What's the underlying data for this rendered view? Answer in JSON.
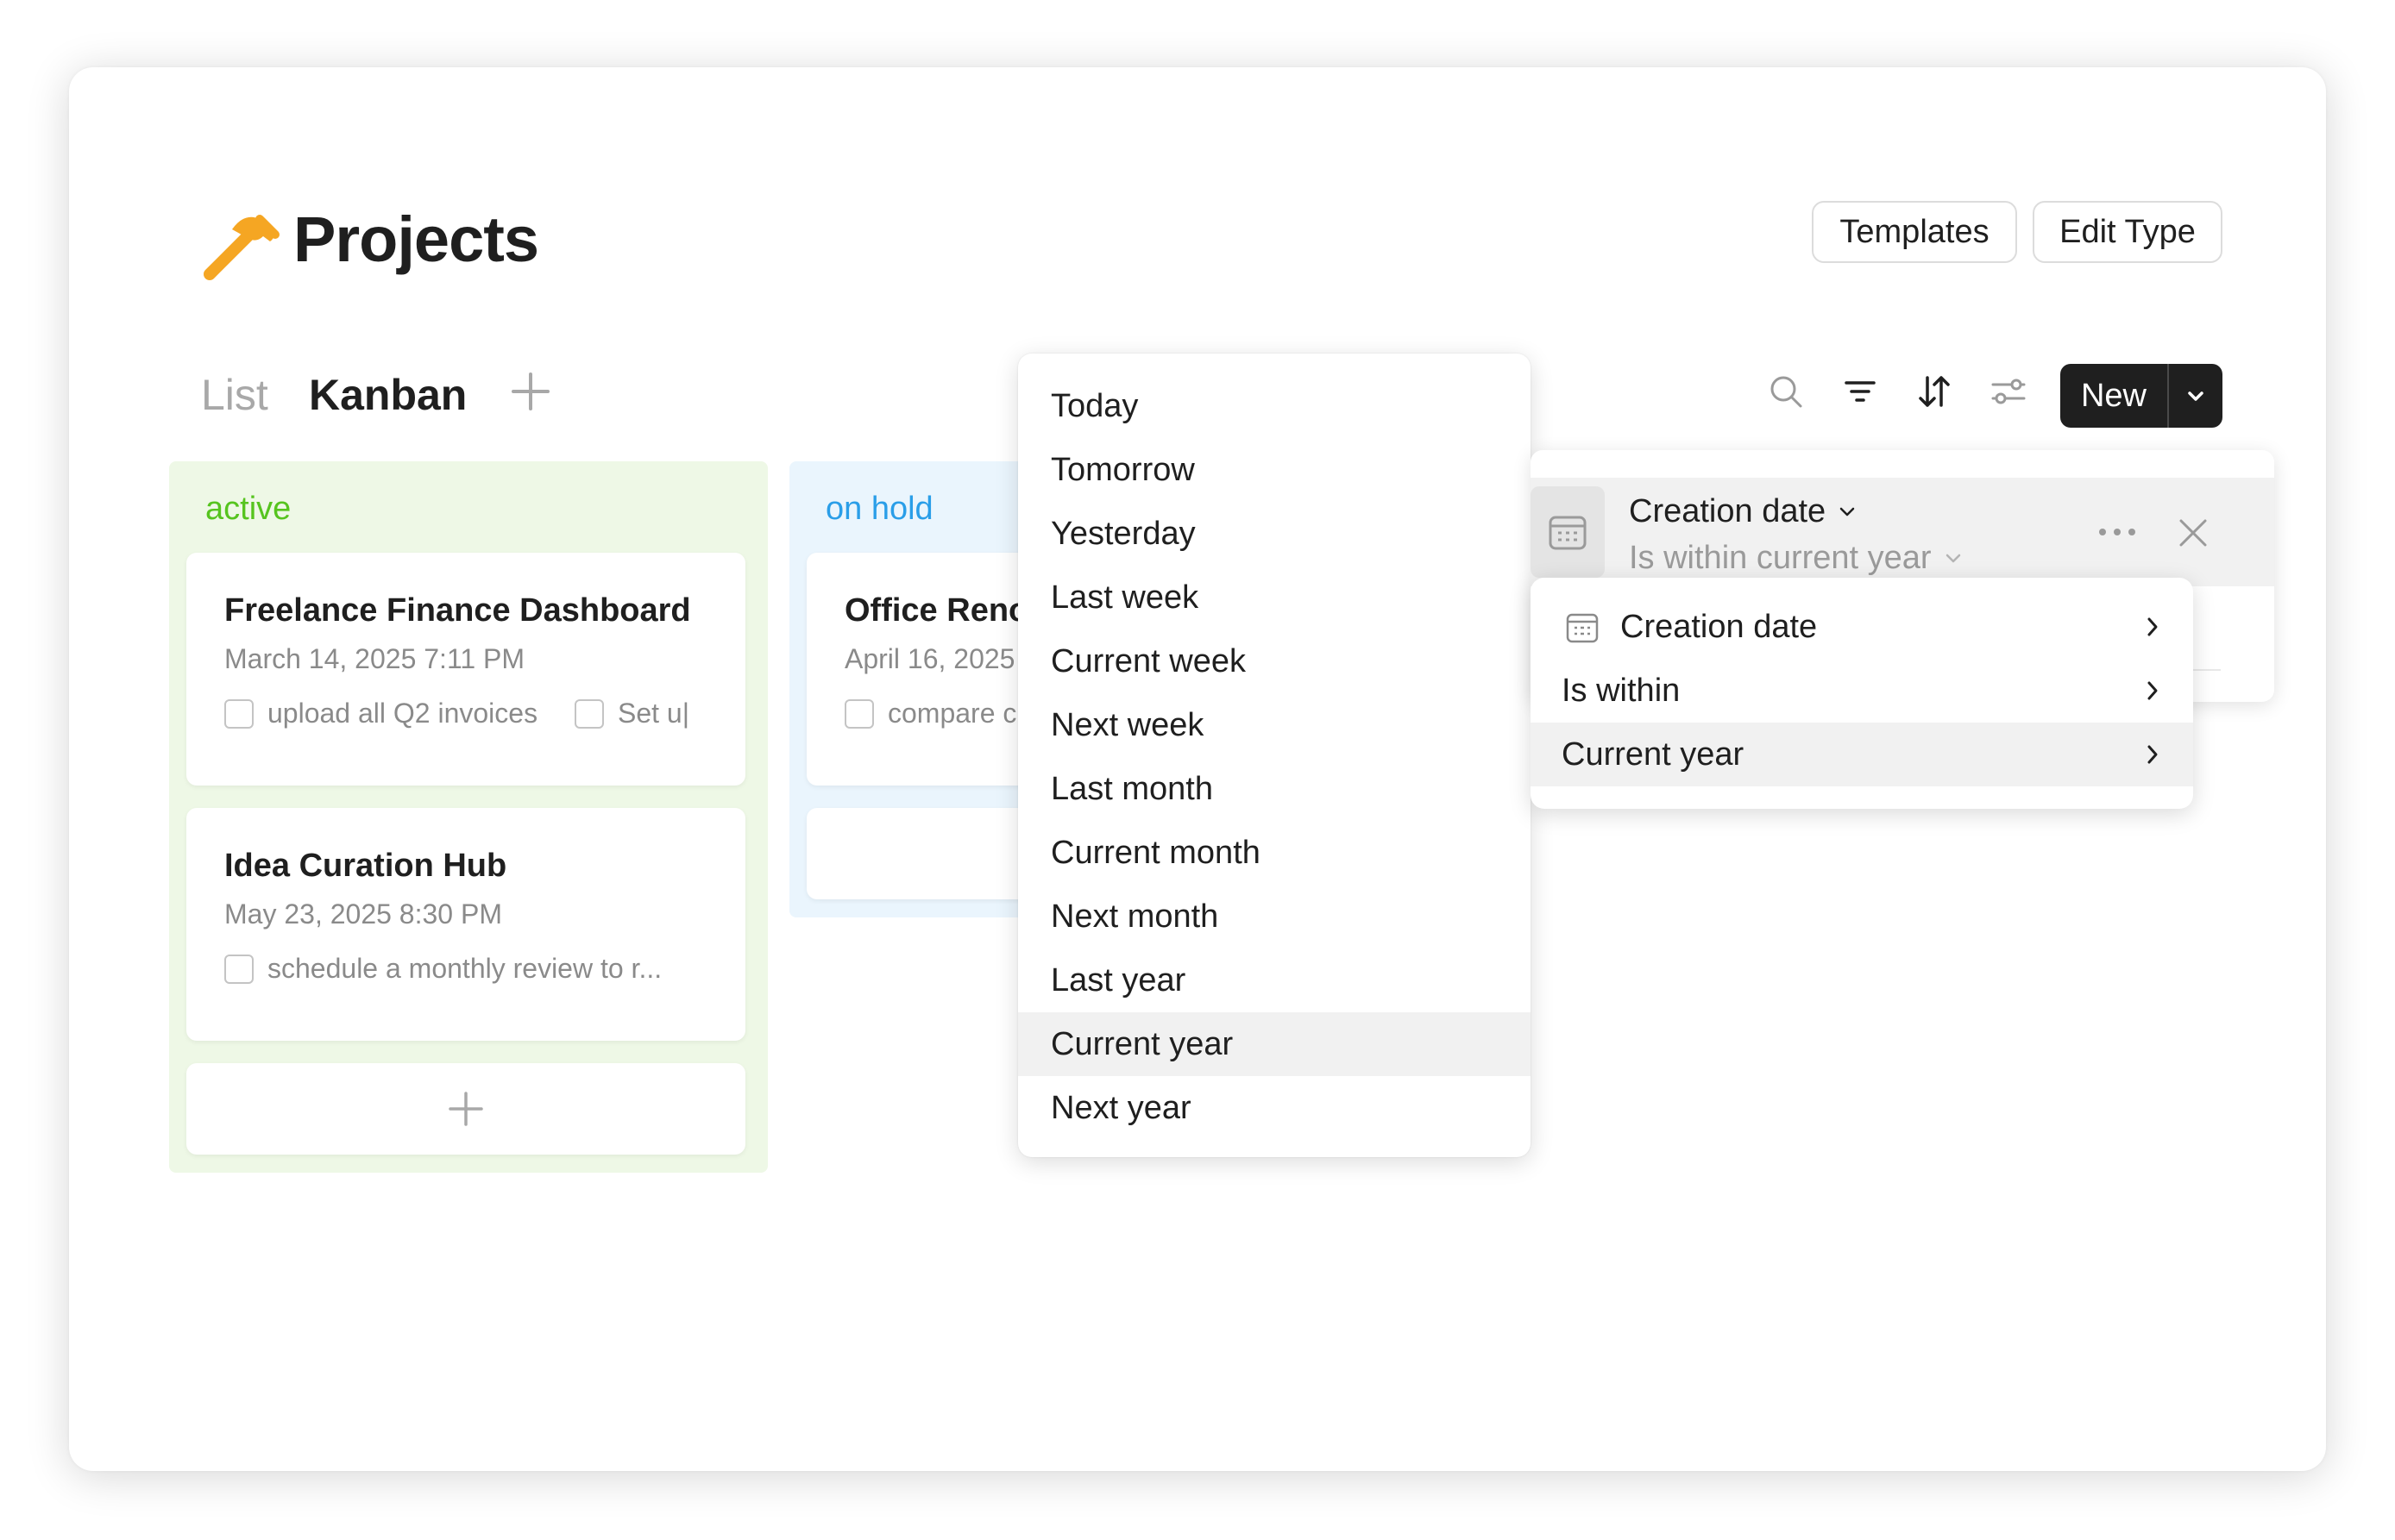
{
  "header": {
    "title": "Projects",
    "templates_label": "Templates",
    "edit_type_label": "Edit Type"
  },
  "views": {
    "tabs": [
      {
        "label": "List",
        "active": false
      },
      {
        "label": "Kanban",
        "active": true
      }
    ]
  },
  "toolbar": {
    "new_label": "New",
    "icons": [
      "search-icon",
      "filter-icon",
      "sort-icon",
      "settings-sliders-icon",
      "chevron-down-icon"
    ]
  },
  "columns": [
    {
      "label": "active",
      "color": "#56c41f",
      "background": "#eef8e6",
      "cards": [
        {
          "title": "Freelance Finance Dashboard",
          "date": "March 14, 2025 7:11 PM",
          "tasks": [
            "upload all Q2 invoices",
            "Set u|"
          ]
        },
        {
          "title": "Idea Curation Hub",
          "date": "May 23, 2025 8:30 PM",
          "tasks": [
            "schedule a monthly review to r..."
          ]
        }
      ]
    },
    {
      "label": "on hold",
      "color": "#2a9ee8",
      "background": "#eaf5fd",
      "cards": [
        {
          "title": "Office Reno",
          "date": "April 16, 2025",
          "tasks": [
            "compare c"
          ]
        }
      ]
    }
  ],
  "date_menu": {
    "items": [
      "Today",
      "Tomorrow",
      "Yesterday",
      "Last week",
      "Current week",
      "Next week",
      "Last month",
      "Current month",
      "Next month",
      "Last year",
      "Current year",
      "Next year"
    ],
    "selected": "Current year"
  },
  "filter": {
    "field": "Creation date",
    "condition": "Is within current year"
  },
  "filter_submenu": {
    "items": [
      {
        "label": "Creation date",
        "icon": "calendar-icon"
      },
      {
        "label": "Is within"
      },
      {
        "label": "Current year",
        "selected": true
      }
    ]
  },
  "colors": {
    "accent_dark": "#1f1f1f",
    "hammer": "#f5a623",
    "selection": "#f1f1f1"
  }
}
